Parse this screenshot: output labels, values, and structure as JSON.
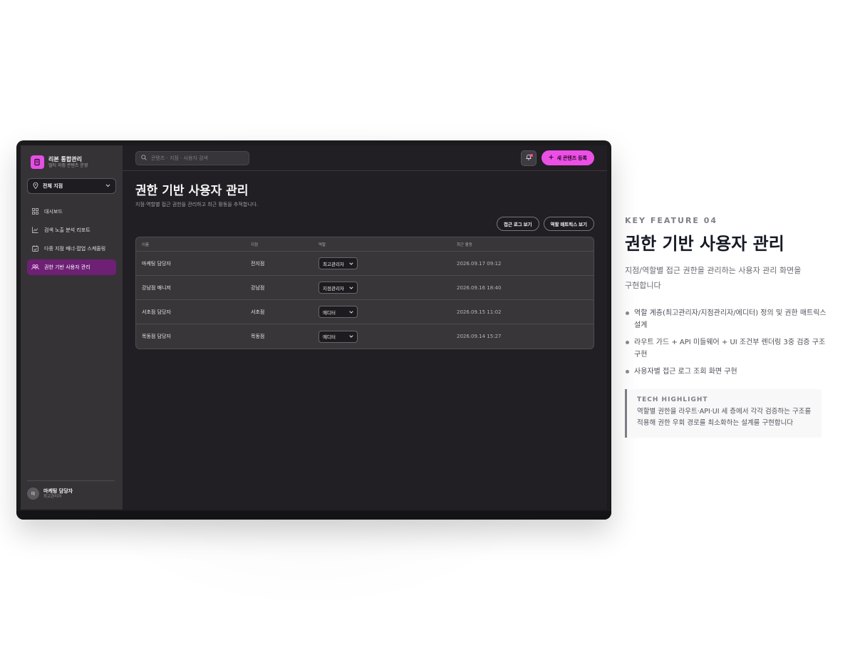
{
  "app": {
    "brand_title": "리본 통합관리",
    "brand_subtitle": "멀티 지점 콘텐츠 운영",
    "branch_select": "전체 지점"
  },
  "sidebar": {
    "items": [
      {
        "label": "대시보드",
        "icon": "grid-icon",
        "active": false
      },
      {
        "label": "검색 노출 분석 리포트",
        "icon": "chart-line-icon",
        "active": false
      },
      {
        "label": "다중 지점 배너·팝업 스케줄링",
        "icon": "calendar-icon",
        "active": false
      },
      {
        "label": "권한 기반 사용자 관리",
        "icon": "users-icon",
        "active": true
      }
    ],
    "user": {
      "avatar": "마",
      "name": "마케팅 담당자",
      "role": "최고관리자"
    }
  },
  "topbar": {
    "search_placeholder": "콘텐츠 · 지점 · 사용자 검색",
    "new_content_button": "새 콘텐츠 등록"
  },
  "page": {
    "title": "권한 기반 사용자 관리",
    "description": "지점·역할별 접근 권한을 관리하고 최근 활동을 추적합니다.",
    "access_log_button": "접근 로그 보기",
    "role_matrix_button": "역할 매트릭스 보기"
  },
  "table": {
    "headers": [
      "이름",
      "지점",
      "역할",
      "최근 활동"
    ],
    "rows": [
      {
        "name": "마케팅 담당자",
        "branch": "전지점",
        "role": "최고관리자",
        "last_activity": "2026.09.17 09:12"
      },
      {
        "name": "강남점 매니저",
        "branch": "강남점",
        "role": "지점관리자",
        "last_activity": "2026.09.16 18:40"
      },
      {
        "name": "서초점 담당자",
        "branch": "서초점",
        "role": "에디터",
        "last_activity": "2026.09.15 11:02"
      },
      {
        "name": "목동점 담당자",
        "branch": "목동점",
        "role": "에디터",
        "last_activity": "2026.09.14 15:27"
      }
    ]
  },
  "feature": {
    "kicker": "KEY FEATURE 04",
    "title": "권한 기반 사용자 관리",
    "description": "지점/역할별 접근 권한을 관리하는 사용자 관리 화면을 구현합니다",
    "bullets": [
      "역할 계층(최고관리자/지점관리자/에디터) 정의 및 권한 매트릭스 설계",
      "라우트 가드 + API 미들웨어 + UI 조건부 렌더링 3중 검증 구조 구현",
      "사용자별 접근 로그 조회 화면 구현"
    ],
    "highlight_title": "TECH HIGHLIGHT",
    "highlight_body": "역할별 권한을 라우트·API·UI 세 층에서 각각 검증하는 구조를 적용해 권한 우회 경로를 최소화하는 설계를 구현합니다"
  },
  "colors": {
    "accent": "#ec4fe6",
    "active_nav": "#6e2074",
    "sidebar_bg": "#363337",
    "main_bg": "#211f23"
  }
}
